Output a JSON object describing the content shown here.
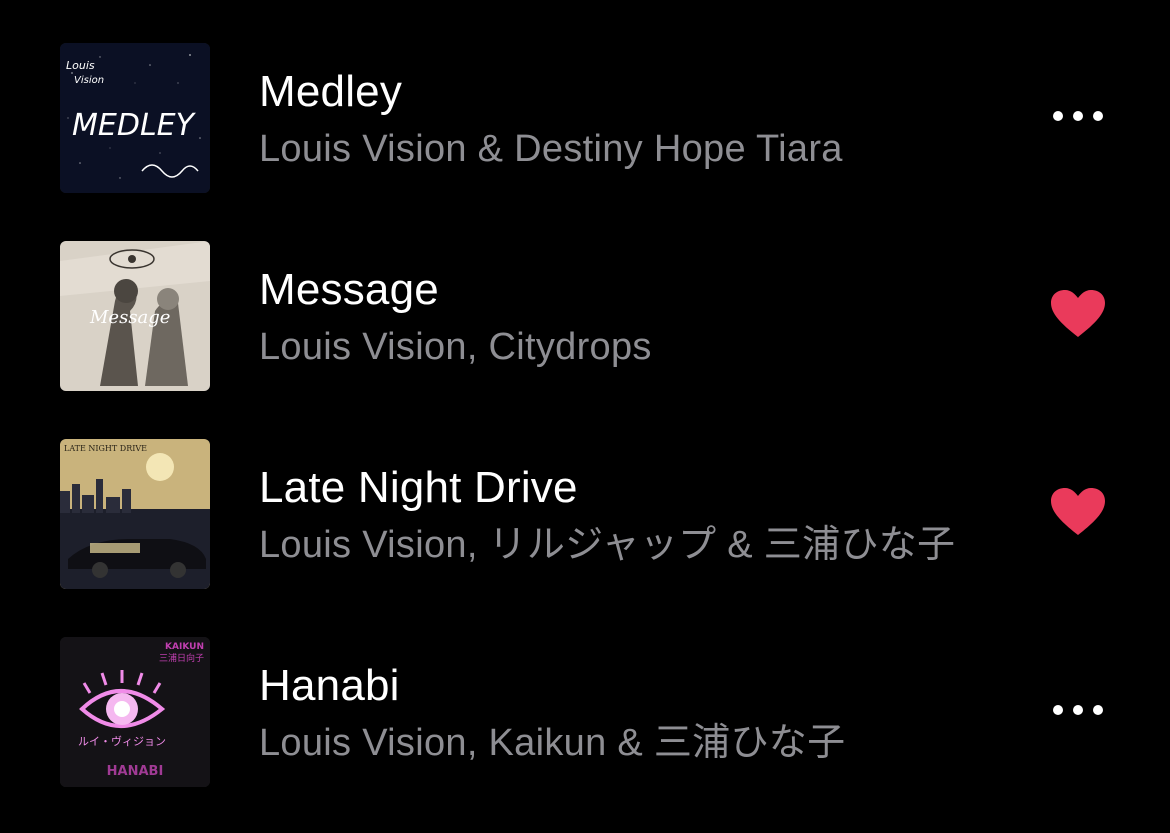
{
  "songs": [
    {
      "title": "Medley",
      "artist": "Louis Vision & Destiny Hope Tiara",
      "action": "more",
      "artwork_icon": "medley-album-art",
      "artwork_text": "MEDLEY"
    },
    {
      "title": "Message",
      "artist": "Louis Vision, Citydrops",
      "action": "love",
      "artwork_icon": "message-album-art",
      "artwork_text": "Message"
    },
    {
      "title": "Late Night Drive",
      "artist": "Louis Vision, リルジャップ & 三浦ひな子",
      "action": "love",
      "artwork_icon": "late-night-drive-album-art",
      "artwork_text": "LATE NIGHT DRIVE"
    },
    {
      "title": "Hanabi",
      "artist": "Louis Vision, Kaikun & 三浦ひな子",
      "action": "more",
      "artwork_icon": "hanabi-album-art",
      "artwork_text_top": "KAIKUN",
      "artwork_text_jp": "三浦日向子",
      "artwork_text_mid": "ルイ・ヴィジョン",
      "artwork_text_bottom": "HANABI"
    }
  ],
  "colors": {
    "background": "#000000",
    "title": "#ffffff",
    "subtitle": "#8e8e93",
    "heart": "#ea3a5b",
    "more": "#ffffff"
  }
}
